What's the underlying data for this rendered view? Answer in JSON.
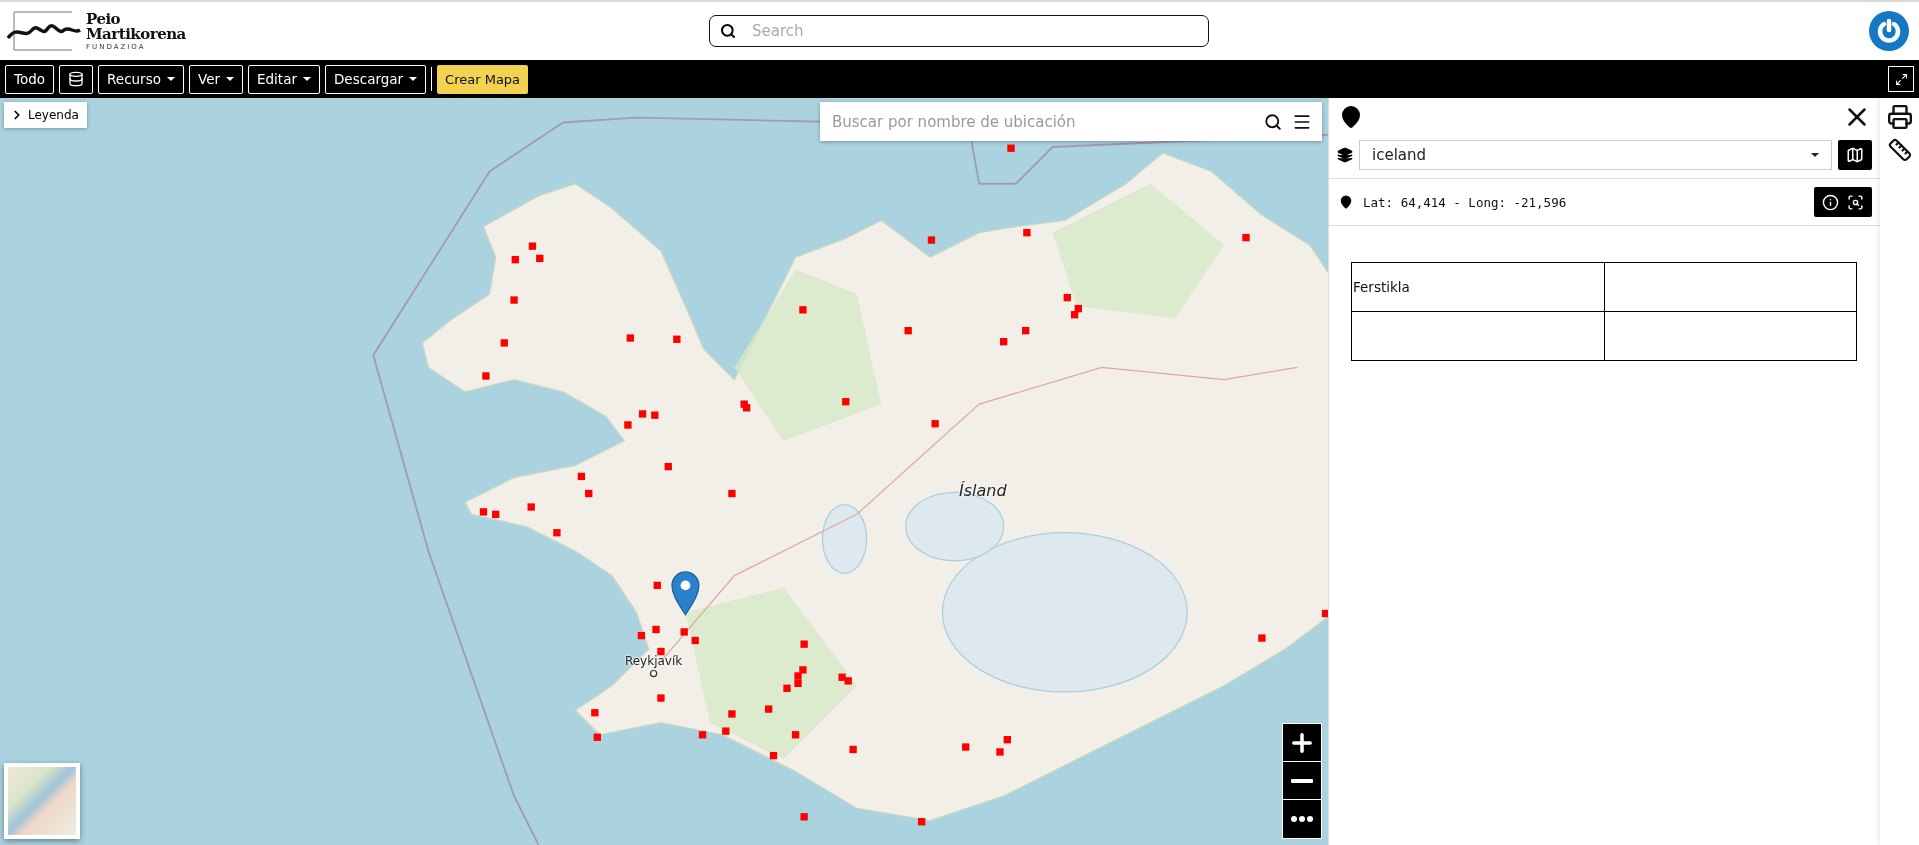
{
  "brand": {
    "line1": "Peio",
    "line2": "Martikorena",
    "subtitle": "FUNDAZIOA"
  },
  "search": {
    "placeholder": "Search"
  },
  "toolbar": [
    {
      "kind": "button",
      "label": "Todo"
    },
    {
      "kind": "icon"
    },
    {
      "kind": "dropdown",
      "label": "Recurso"
    },
    {
      "kind": "dropdown",
      "label": "Ver"
    },
    {
      "kind": "dropdown",
      "label": "Editar"
    },
    {
      "kind": "dropdown",
      "label": "Descargar"
    },
    {
      "kind": "separator"
    },
    {
      "kind": "primary",
      "label": "Crear Mapa"
    }
  ],
  "map": {
    "legend": "Leyenda",
    "search_placeholder": "Buscar por nombre de ubicación",
    "labels": [
      {
        "kind": "region",
        "text": "Ísland"
      },
      {
        "kind": "city",
        "text": "Reykjavík"
      }
    ]
  },
  "panel": {
    "layer": "iceland",
    "coordinates": "Lat: 64,414 - Long: -21,596",
    "table": {
      "first_cell": "Ferstikla"
    }
  }
}
